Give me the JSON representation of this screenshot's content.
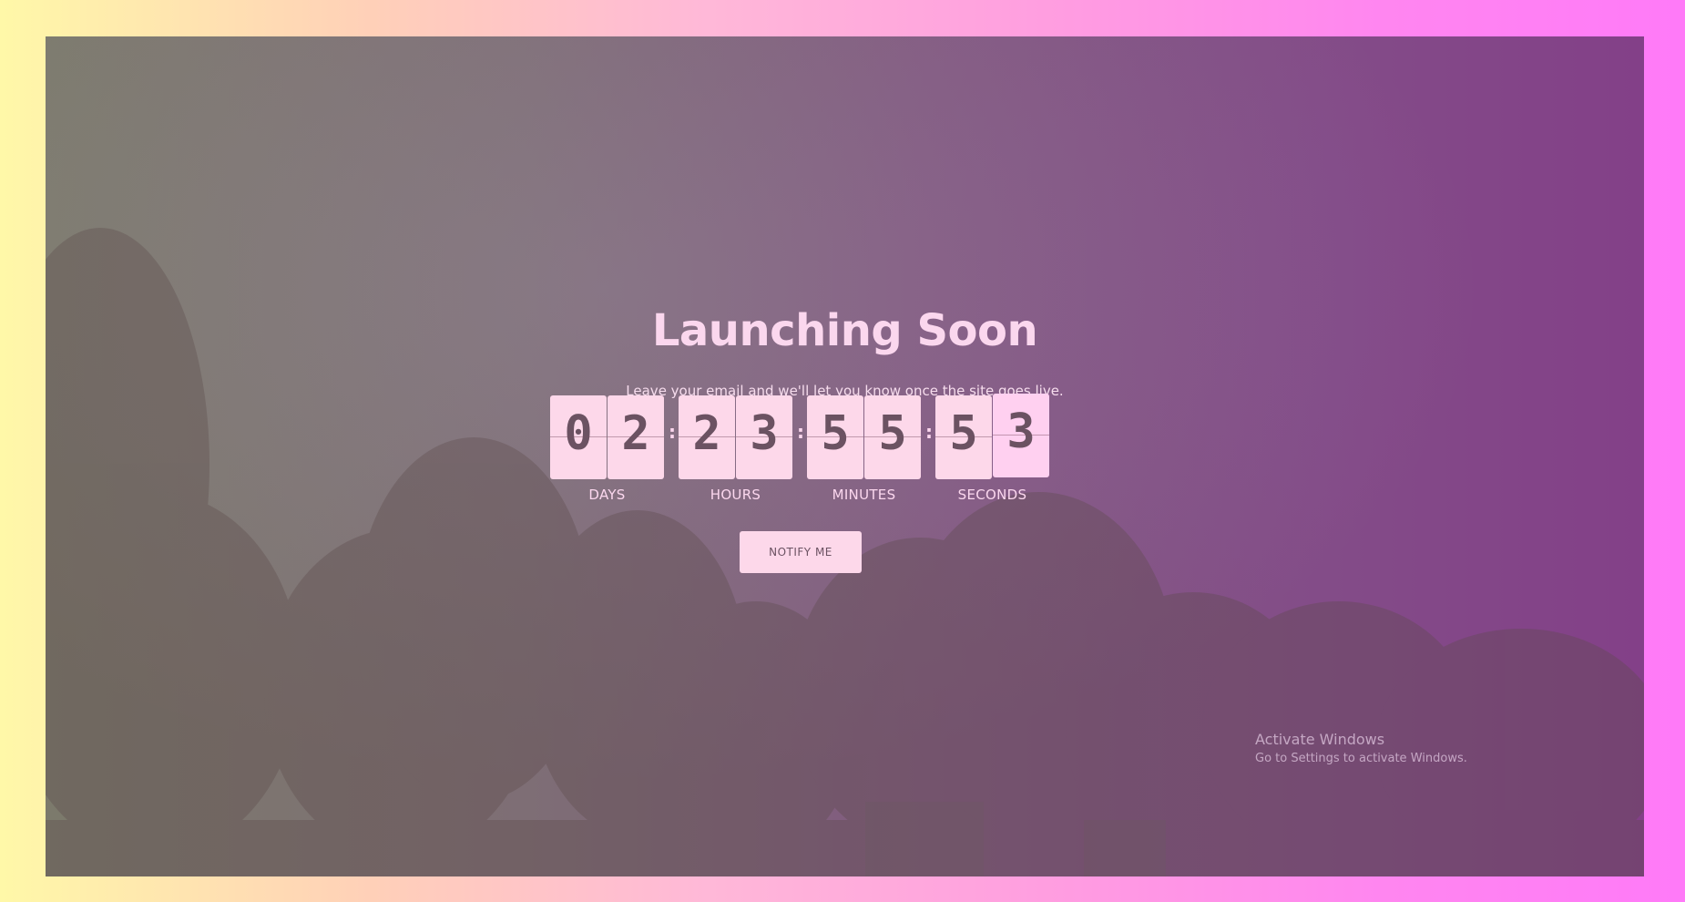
{
  "page": {
    "title": "Launching Soon",
    "subtitle": "Leave your email and we'll let you know once the site goes live."
  },
  "countdown": {
    "digits": [
      "0",
      "2",
      "2",
      "3",
      "5",
      "5",
      "5",
      "3"
    ],
    "labels": [
      "DAYS",
      "HOURS",
      "MINUTES",
      "SECONDS"
    ],
    "separator": ":"
  },
  "cta": {
    "label": "NOTIFY ME"
  },
  "watermark": {
    "title": "Activate Windows",
    "subtitle": "Go to Settings to activate Windows."
  },
  "colors": {
    "card": "#fdd8ea",
    "digit": "#6b5262",
    "text": "#fbd7ee"
  }
}
